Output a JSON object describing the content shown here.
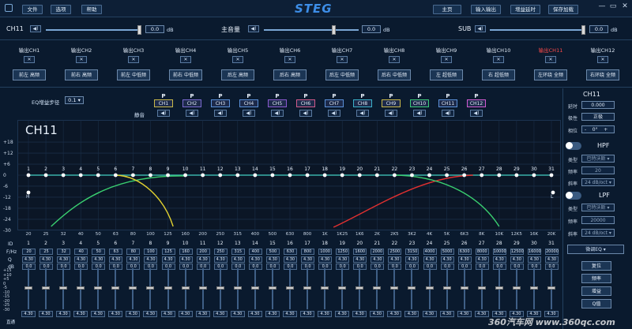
{
  "app": {
    "logo": "STEG"
  },
  "menu": {
    "file": "文件",
    "options": "选项",
    "help": "帮助"
  },
  "nav": {
    "home": "主页",
    "io": "输入输出",
    "gain_delay": "增益延时",
    "save_load": "保存加载"
  },
  "master": {
    "ch_label": "CH11",
    "ch_value": "0.0",
    "ch_unit": "dB",
    "main_label": "主音量",
    "main_value": "0.0",
    "main_unit": "dB",
    "sub_label": "SUB",
    "sub_value": "0.0",
    "sub_unit": "dB"
  },
  "outputs": [
    {
      "label": "输出CH1",
      "sel": "前左 高频"
    },
    {
      "label": "输出CH2",
      "sel": "前右 高频"
    },
    {
      "label": "输出CH3",
      "sel": "前左 中低频"
    },
    {
      "label": "输出CH4",
      "sel": "前右 中低频"
    },
    {
      "label": "输出CH5",
      "sel": "后左 高频"
    },
    {
      "label": "输出CH6",
      "sel": "后右 高频"
    },
    {
      "label": "输出CH7",
      "sel": "后左 中低频"
    },
    {
      "label": "输出CH8",
      "sel": "后右 中低频"
    },
    {
      "label": "输出CH9",
      "sel": "左 超低频"
    },
    {
      "label": "输出CH10",
      "sel": "右 超低频"
    },
    {
      "label": "输出CH11",
      "sel": "左环绕 全频"
    },
    {
      "label": "输出CH12",
      "sel": "右环绕 全频"
    }
  ],
  "eq_step": {
    "label": "EQ增益步径",
    "value": "0.1"
  },
  "mute_label": "静音",
  "channels": [
    {
      "name": "CH1",
      "color": "#c9b84a"
    },
    {
      "name": "CH2",
      "color": "#7a6ad0"
    },
    {
      "name": "CH3",
      "color": "#5a90d8"
    },
    {
      "name": "CH4",
      "color": "#5a90d8"
    },
    {
      "name": "CH5",
      "color": "#8a5ad0"
    },
    {
      "name": "CH6",
      "color": "#d05a8a"
    },
    {
      "name": "CH7",
      "color": "#5a90d8"
    },
    {
      "name": "CH8",
      "color": "#3ab0c8"
    },
    {
      "name": "CH9",
      "color": "#c9b84a"
    },
    {
      "name": "CH10",
      "color": "#3ac878"
    },
    {
      "name": "CH11",
      "color": "#5a90d8"
    },
    {
      "name": "CH12",
      "color": "#d05ad0"
    }
  ],
  "p_label": "P",
  "graph": {
    "title": "CH11",
    "yticks": [
      "+18",
      "+12",
      "+6",
      "0",
      "-6",
      "-12",
      "-18",
      "-24",
      "-30"
    ],
    "xticks": [
      "20",
      "25",
      "32",
      "40",
      "50",
      "63",
      "80",
      "100",
      "125",
      "160",
      "200",
      "250",
      "315",
      "400",
      "500",
      "630",
      "800",
      "1K",
      "1K25",
      "1K6",
      "2K",
      "2K5",
      "3K2",
      "4K",
      "5K",
      "6K3",
      "8K",
      "10K",
      "12K5",
      "16K",
      "20K"
    ],
    "h_label": "H",
    "l_label": "L"
  },
  "table": {
    "id_label": "ID",
    "freq_label": "F/Hz",
    "q_label": "Q",
    "db_label": "dB",
    "ids": [
      "1",
      "2",
      "3",
      "4",
      "5",
      "6",
      "7",
      "8",
      "9",
      "10",
      "11",
      "12",
      "13",
      "14",
      "15",
      "16",
      "17",
      "18",
      "19",
      "20",
      "21",
      "22",
      "23",
      "24",
      "25",
      "26",
      "27",
      "28",
      "29",
      "30",
      "31"
    ],
    "freqs": [
      "20",
      "25",
      "32",
      "40",
      "50",
      "63",
      "80",
      "100",
      "125",
      "160",
      "200",
      "250",
      "315",
      "400",
      "500",
      "630",
      "800",
      "1000",
      "1250",
      "1600",
      "2000",
      "2500",
      "3150",
      "4000",
      "5000",
      "6300",
      "8000",
      "10000",
      "12500",
      "16000",
      "20000"
    ],
    "q": "4.30",
    "db": "0.0"
  },
  "fader_scale": [
    "+15",
    "+10",
    "+5",
    "0",
    "-5",
    "-10",
    "-15",
    "-20",
    "-25",
    "-30"
  ],
  "fader_bottom": "直通",
  "right": {
    "title": "CH11",
    "delay_label": "延时",
    "delay_value": "0.000",
    "polarity_label": "极性",
    "polarity_value": "正极",
    "phase_label": "相位",
    "phase_value": "0°",
    "hpf": "HPF",
    "type_label": "类型",
    "hpf_type": "巴特沃斯",
    "freq_label": "频率",
    "hpf_freq": "20",
    "slope_label": "斜率",
    "hpf_slope": "24 dB/oct",
    "lpf": "LPF",
    "lpf_type": "巴特沃斯",
    "lpf_freq": "20000",
    "lpf_slope": "24 dB/oct",
    "eq_mode": "微调EQ",
    "reset": "复位",
    "bypass": "频率",
    "gain": "增益",
    "qval": "Q值"
  },
  "watermark": "360汽车网 www.360qc.com"
}
